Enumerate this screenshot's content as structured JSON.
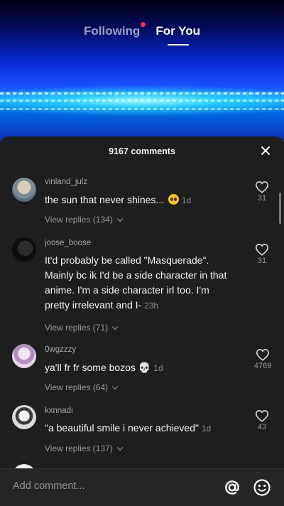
{
  "nav": {
    "following_label": "Following",
    "foryou_label": "For You"
  },
  "sheet": {
    "comment_count": "9167 comments"
  },
  "comments": [
    {
      "username": "vinland_julz",
      "text": "the sun that never shines...",
      "emoji": "pleading-face-emoji",
      "time": "1d",
      "replies": "View replies (134)",
      "likes": "31"
    },
    {
      "username": "joose_boose",
      "text": "It'd probably be called \"Masquerade\". Mainly bc ik I'd be a side character in that anime. I'm a side character irl too. I'm pretty irrelevant and I-",
      "time": "23h",
      "replies": "View replies (71)",
      "likes": "31"
    },
    {
      "username": "0wgzzzy",
      "text": "ya'll fr fr some bozos",
      "emoji": "💀",
      "time": "1d",
      "replies": "View replies (64)",
      "likes": "4769"
    },
    {
      "username": "kxnnadi",
      "text": "\"a beautiful smile i never achieved\"",
      "time": "1d",
      "replies": "View replies (137)",
      "likes": "43"
    }
  ],
  "input": {
    "placeholder": "Add comment..."
  },
  "colors": {
    "accent": "#fe2c55",
    "sheet_bg": "#1e1e1e",
    "bar_bg": "#262626"
  }
}
